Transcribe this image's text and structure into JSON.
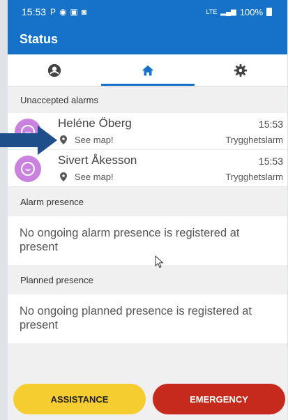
{
  "status_bar": {
    "time": "15:53",
    "left_icons": [
      "parking-icon",
      "eye-icon",
      "screen-icon",
      "mail-icon"
    ],
    "signal": "LTE",
    "battery": "100%"
  },
  "app_bar": {
    "title": "Status"
  },
  "tabs": [
    {
      "icon": "person-icon",
      "active": false
    },
    {
      "icon": "home-icon",
      "active": true
    },
    {
      "icon": "gear-icon",
      "active": false
    }
  ],
  "unaccepted": {
    "header": "Unaccepted alarms",
    "alarms": [
      {
        "name": "Heléne Öberg",
        "time": "15:53",
        "map_link": "See map!",
        "type": "Trygghetslarm"
      },
      {
        "name": "Sivert Åkesson",
        "time": "15:53",
        "map_link": "See map!",
        "type": "Trygghetslarm"
      }
    ]
  },
  "alarm_presence": {
    "header": "Alarm presence",
    "message": "No ongoing alarm presence is registered at present"
  },
  "planned_presence": {
    "header": "Planned presence",
    "message": "No ongoing planned presence is registered at present"
  },
  "footer": {
    "assistance_label": "ASSISTANCE",
    "emergency_label": "EMERGENCY"
  },
  "colors": {
    "primary": "#1672c8",
    "avatar": "#c983de",
    "assistance": "#f6cd30",
    "emergency": "#c62a1c"
  }
}
